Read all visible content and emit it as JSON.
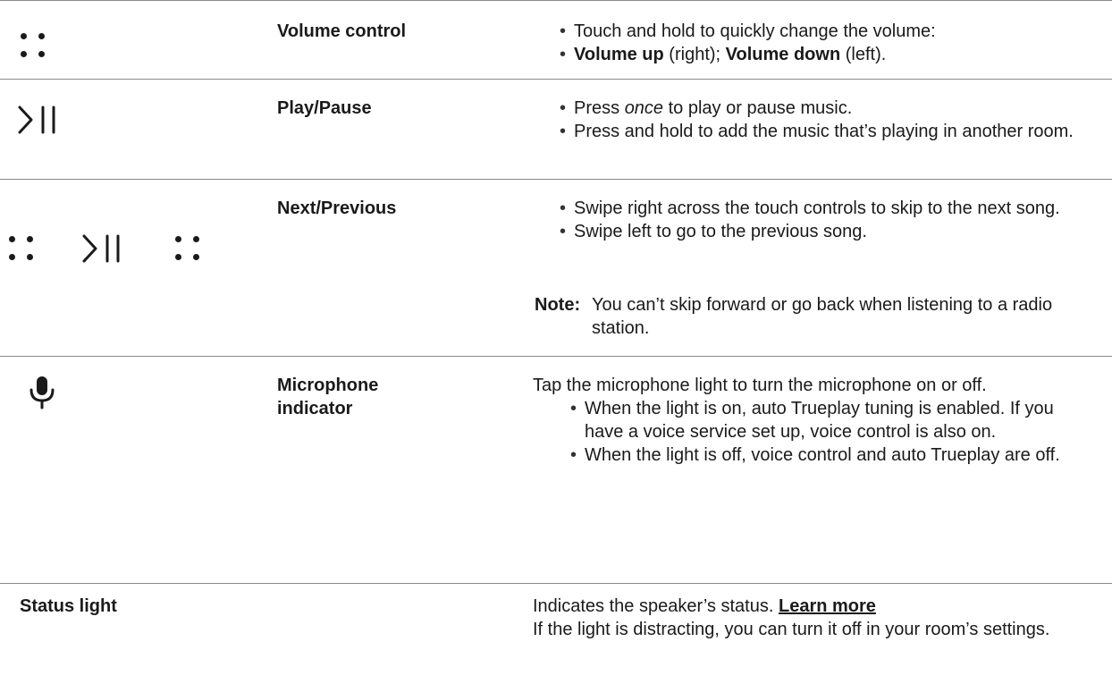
{
  "rows": [
    {
      "label": "Volume control",
      "bullets": [
        "Touch and hold to quickly change the volume:"
      ],
      "bullet2": {
        "up_label": "Volume up",
        "up_suffix": " (right); ",
        "down_label": "Volume down",
        "down_suffix": " (left)."
      }
    },
    {
      "label": "Play/Pause",
      "bullet1": {
        "before": "Press ",
        "em": "once",
        "after": " to play or pause music."
      },
      "bullet2": "Press and hold to add the music that’s playing in another room."
    },
    {
      "label": "Next/Previous",
      "bullet1": "Swipe right across the touch controls to skip to the next song.",
      "bullet2": "Swipe left to go to the previous song.",
      "note_key": "Note:",
      "note_text": "You can’t skip forward or go back when listening to a radio station."
    },
    {
      "label": "Microphone indicator",
      "intro": "Tap the microphone light to turn the microphone on or off.",
      "bullet1": "When the light is on, auto Trueplay tuning is enabled. If you have a voice service set up, voice control is also on.",
      "bullet2": "When the light is off, voice control and auto Trueplay are off."
    },
    {
      "label": "Status light",
      "line1": "Indicates the speaker’s status. ",
      "link": "Learn more",
      "line2": "If the light is distracting, you can turn it off in your room’s settings."
    }
  ],
  "icons": {
    "volume": "volume-dots-icon",
    "play_pause": "play-pause-icon",
    "next_prev": "swipe-controls-icon",
    "microphone": "microphone-icon"
  }
}
